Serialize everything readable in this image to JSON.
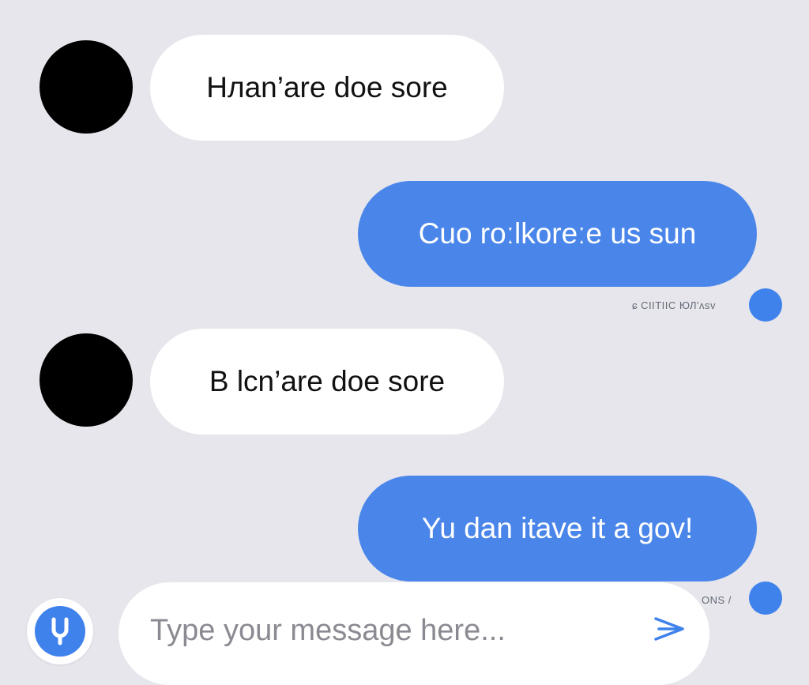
{
  "messages": [
    {
      "direction": "incoming",
      "text": "Hлan’are doe sore"
    },
    {
      "direction": "outgoing",
      "text": "Cuo roːlkoreːe us sun",
      "status": "ɕ CIITIIC ЮЛ'ʌsv"
    },
    {
      "direction": "incoming",
      "text": "B lcn’are doe sore"
    },
    {
      "direction": "outgoing",
      "text": "Yu dan itave it a gov!",
      "status": "ONS /"
    }
  ],
  "composer": {
    "placeholder": "Type your message here...",
    "value": ""
  },
  "colors": {
    "background": "#e6e6ec",
    "incoming_bubble": "#ffffff",
    "outgoing_bubble": "#4a86ea",
    "accent": "#3f82ec"
  },
  "icons": {
    "mic": "microphone-icon",
    "send": "send-arrow-icon"
  }
}
